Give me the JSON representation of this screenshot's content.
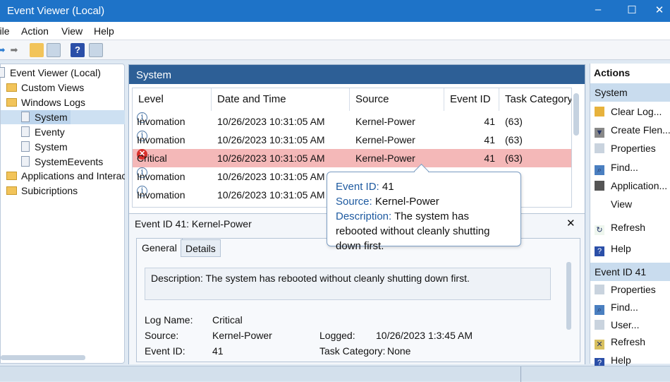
{
  "window": {
    "title": "Event Viewer (Local)",
    "minimize": "–",
    "maximize": "☐",
    "close": "✕"
  },
  "menu": [
    "File",
    "Action",
    "View",
    "Help"
  ],
  "tree": {
    "root": "Event Viewer (Local)",
    "custom_views": "Custom Views",
    "windows_logs": "Windows Logs",
    "children": [
      "System",
      "Eventy",
      "System",
      "SystemEevents"
    ],
    "apps": "Applications and Interac",
    "subscriptions": "Subicriptions"
  },
  "panel": {
    "title": "System"
  },
  "table": {
    "columns": [
      "Level",
      "Date and Time",
      "Source",
      "Event ID",
      "Task Category"
    ],
    "rows": [
      {
        "level": "Invomation",
        "date": "10/26/2023 10:31:05 AM",
        "source": "Kernel-Power",
        "id": "41",
        "task": "(63)",
        "type": "info"
      },
      {
        "level": "Invomation",
        "date": "10/26/2023 10:31:05 AM",
        "source": "Kernel-Power",
        "id": "41",
        "task": "(63)",
        "type": "info"
      },
      {
        "level": "Critical",
        "date": "10/26/2023 10:31:05 AM",
        "source": "Kernel-Power",
        "id": "41",
        "task": "(63)",
        "type": "critical"
      },
      {
        "level": "Invomation",
        "date": "10/26/2023 10:31:05 AM",
        "source": "",
        "id": "",
        "task": "",
        "type": "info"
      },
      {
        "level": "Invomation",
        "date": "10/26/2023 10:31:05 AM",
        "source": "",
        "id": "",
        "task": "",
        "type": "info"
      }
    ]
  },
  "tooltip": {
    "id_label": "Event ID:",
    "id": "41",
    "source_label": "Source:",
    "source": "Kernel-Power",
    "desc_label": "Description:",
    "desc": "The system has rebooted without cleanly shutting down first."
  },
  "detail": {
    "title": "Event ID 41: Kernel-Power",
    "close": "✕",
    "tabs": [
      "General",
      "Details"
    ],
    "description": "Description: The system has rebooted without cleanly shutting down first.",
    "log_name_label": "Log Name:",
    "log_name": "Critical",
    "source_label": "Source:",
    "source": "Kernel-Power",
    "logged_label": "Logged:",
    "logged": "10/26/2023 1:3:45 AM",
    "event_id_label": "Event ID:",
    "event_id": "41",
    "task_label": "Task Category:",
    "task": "None"
  },
  "actions": {
    "title": "Actions",
    "section1": "System",
    "items1": [
      "Clear Log...",
      "Create Flen...",
      "Properties",
      "Find...",
      "Application...",
      "View",
      "Refresh",
      "Help"
    ],
    "section2": "Event ID 41",
    "items2": [
      "Properties",
      "Find...",
      "User...",
      "Refresh",
      "Help"
    ]
  }
}
